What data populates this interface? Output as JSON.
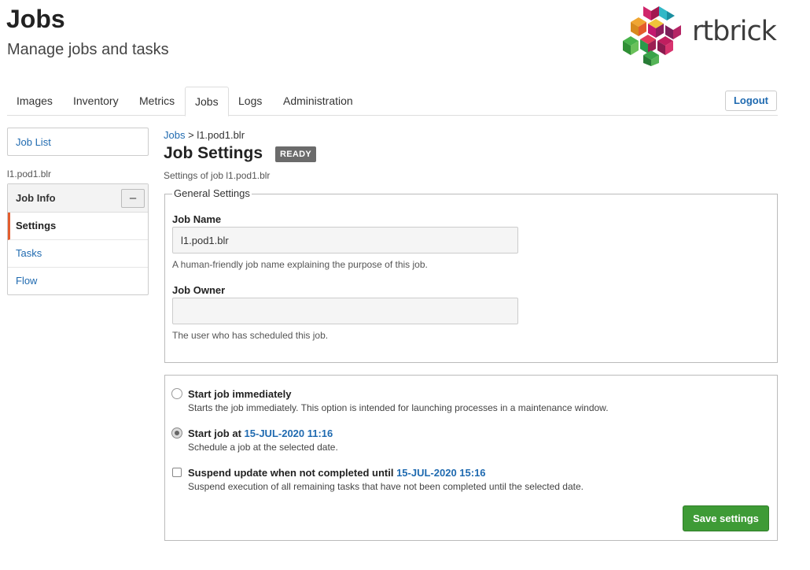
{
  "header": {
    "title": "Jobs",
    "subtitle": "Manage jobs and tasks",
    "logo_text": "rtbrick"
  },
  "nav": {
    "tabs": [
      "Images",
      "Inventory",
      "Metrics",
      "Jobs",
      "Logs",
      "Administration"
    ],
    "active_tab": "Jobs",
    "logout_label": "Logout"
  },
  "sidebar": {
    "job_list_label": "Job List",
    "caption": "l1.pod1.blr",
    "panel_title": "Job Info",
    "collapse_symbol": "–",
    "items": [
      "Settings",
      "Tasks",
      "Flow"
    ],
    "active_item": "Settings"
  },
  "main": {
    "breadcrumb_root": "Jobs",
    "breadcrumb_sep": ">",
    "breadcrumb_current": "l1.pod1.blr",
    "title": "Job Settings",
    "status": "READY",
    "description": "Settings of job l1.pod1.blr",
    "general": {
      "legend": "General Settings",
      "job_name_label": "Job Name",
      "job_name_value": "l1.pod1.blr",
      "job_name_help": "A human-friendly job name explaining the purpose of this job.",
      "job_owner_label": "Job Owner",
      "job_owner_value": "",
      "job_owner_help": "The user who has scheduled this job."
    },
    "schedule": {
      "immediate_label": "Start job immediately",
      "immediate_help": "Starts the job immediately. This option is intended for launching processes in a maintenance window.",
      "at_label": "Start job at",
      "at_date": "15-JUL-2020 11:16",
      "at_help": "Schedule a job at the selected date.",
      "suspend_label": "Suspend update when not completed until",
      "suspend_date": "15-JUL-2020 15:16",
      "suspend_help": "Suspend execution of all remaining tasks that have not been completed until the selected date.",
      "selected": "at",
      "suspend_checked": false
    },
    "save_label": "Save settings"
  },
  "colors": {
    "link": "#1f6ab0",
    "save_button": "#3e9b36",
    "active_marker": "#e35d2e",
    "badge": "#6b6b6b"
  }
}
